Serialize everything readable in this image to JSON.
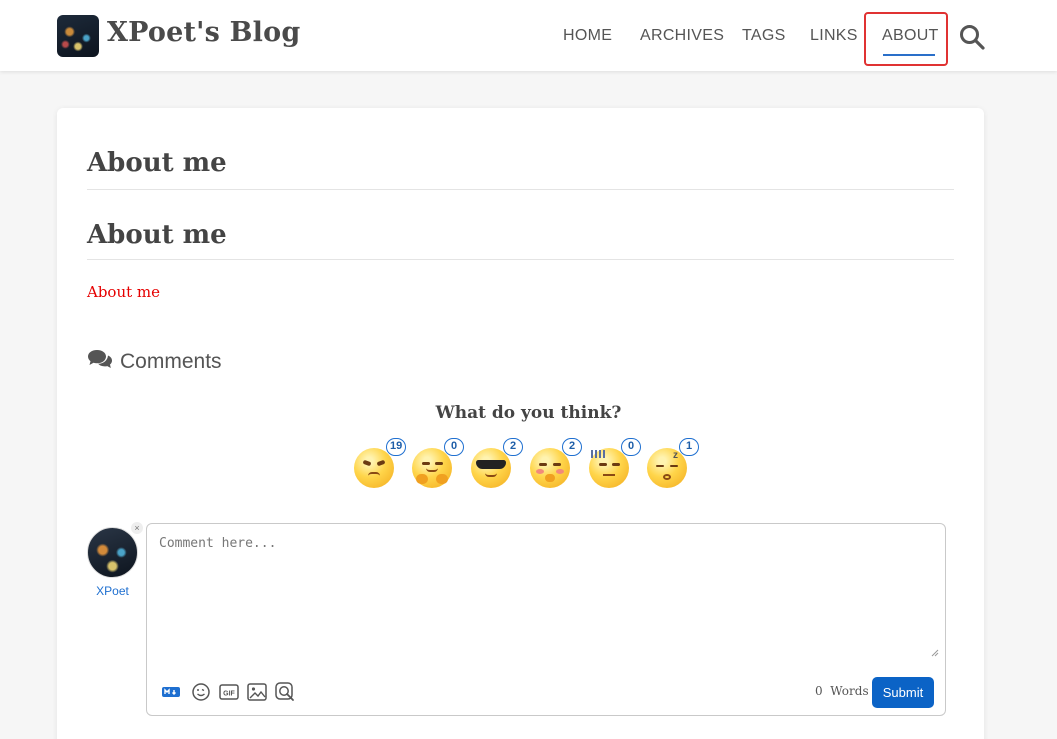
{
  "header": {
    "site_title": "XPoet's Blog",
    "nav": [
      {
        "label": "HOME"
      },
      {
        "label": "ARCHIVES"
      },
      {
        "label": "TAGS"
      },
      {
        "label": "LINKS"
      },
      {
        "label": "ABOUT",
        "active": true
      }
    ],
    "search_icon": "search-icon",
    "accent_color": "#2a6fc9",
    "highlight_color": "#e03232"
  },
  "page": {
    "title": "About me",
    "heading": "About me",
    "link_text": "About me",
    "link_color": "#e60000"
  },
  "comments": {
    "heading": "Comments",
    "prompt": "What do you think?",
    "reactions": [
      {
        "icon": "angry-emoji-icon",
        "count": "19"
      },
      {
        "icon": "hug-emoji-icon",
        "count": "0"
      },
      {
        "icon": "cool-emoji-icon",
        "count": "2"
      },
      {
        "icon": "shy-emoji-icon",
        "count": "2"
      },
      {
        "icon": "speechless-emoji-icon",
        "count": "0"
      },
      {
        "icon": "sleepy-emoji-icon",
        "count": "1"
      }
    ],
    "user_name": "XPoet",
    "placeholder": "Comment here...",
    "word_count": "0",
    "word_label": "Words",
    "submit_label": "Submit",
    "toolbar_icons": [
      "markdown-icon",
      "emoji-icon",
      "gif-icon",
      "image-icon",
      "preview-icon"
    ],
    "button_color": "#0b63c6"
  }
}
